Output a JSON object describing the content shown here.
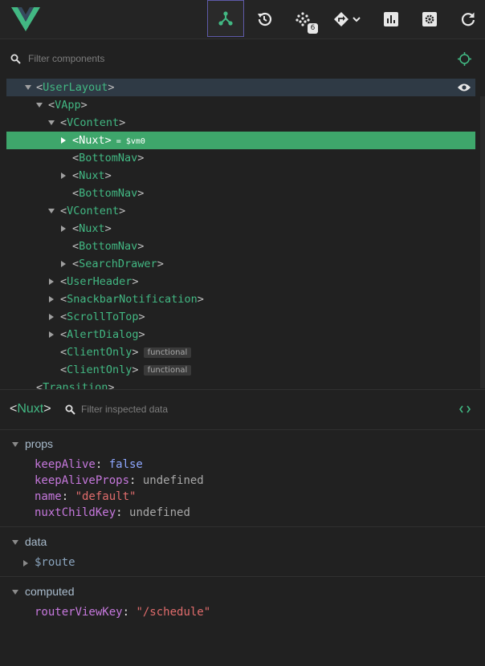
{
  "toolbar": {
    "badge_count": "6",
    "colors": {
      "accent": "#42b883",
      "active_border": "#5e5aa8",
      "icon": "#e8e8e8"
    },
    "icons": [
      "components-icon",
      "history-icon",
      "vuex-icon",
      "routes-icon",
      "performance-icon",
      "settings-icon",
      "refresh-icon"
    ]
  },
  "filter": {
    "placeholder": "Filter components"
  },
  "tree": {
    "rows": [
      {
        "name": "UserLayout",
        "extra": "",
        "badge": ""
      },
      {
        "name": "VApp",
        "extra": "",
        "badge": ""
      },
      {
        "name": "VContent",
        "extra": "",
        "badge": ""
      },
      {
        "name": "Nuxt",
        "extra": "= $vm0",
        "badge": ""
      },
      {
        "name": "BottomNav",
        "extra": "",
        "badge": ""
      },
      {
        "name": "Nuxt",
        "extra": "",
        "badge": ""
      },
      {
        "name": "BottomNav",
        "extra": "",
        "badge": ""
      },
      {
        "name": "VContent",
        "extra": "",
        "badge": ""
      },
      {
        "name": "Nuxt",
        "extra": "",
        "badge": ""
      },
      {
        "name": "BottomNav",
        "extra": "",
        "badge": ""
      },
      {
        "name": "SearchDrawer",
        "extra": "",
        "badge": ""
      },
      {
        "name": "UserHeader",
        "extra": "",
        "badge": ""
      },
      {
        "name": "SnackbarNotification",
        "extra": "",
        "badge": ""
      },
      {
        "name": "ScrollToTop",
        "extra": "",
        "badge": ""
      },
      {
        "name": "AlertDialog",
        "extra": "",
        "badge": ""
      },
      {
        "name": "ClientOnly",
        "extra": "",
        "badge": "functional"
      },
      {
        "name": "ClientOnly",
        "extra": "",
        "badge": "functional"
      },
      {
        "name": "Transition",
        "extra": "",
        "badge": ""
      }
    ]
  },
  "inspector": {
    "component": "Nuxt",
    "filter_placeholder": "Filter inspected data",
    "sections": {
      "props": {
        "title": "props",
        "items": [
          {
            "key": "keepAlive",
            "value": "false"
          },
          {
            "key": "keepAliveProps",
            "value": "undefined"
          },
          {
            "key": "name",
            "value": "\"default\""
          },
          {
            "key": "nuxtChildKey",
            "value": "undefined"
          }
        ]
      },
      "data": {
        "title": "data",
        "items": [
          {
            "key": "$route"
          }
        ]
      },
      "computed": {
        "title": "computed",
        "items": [
          {
            "key": "routerViewKey",
            "value": "\"/schedule\""
          }
        ]
      }
    }
  }
}
